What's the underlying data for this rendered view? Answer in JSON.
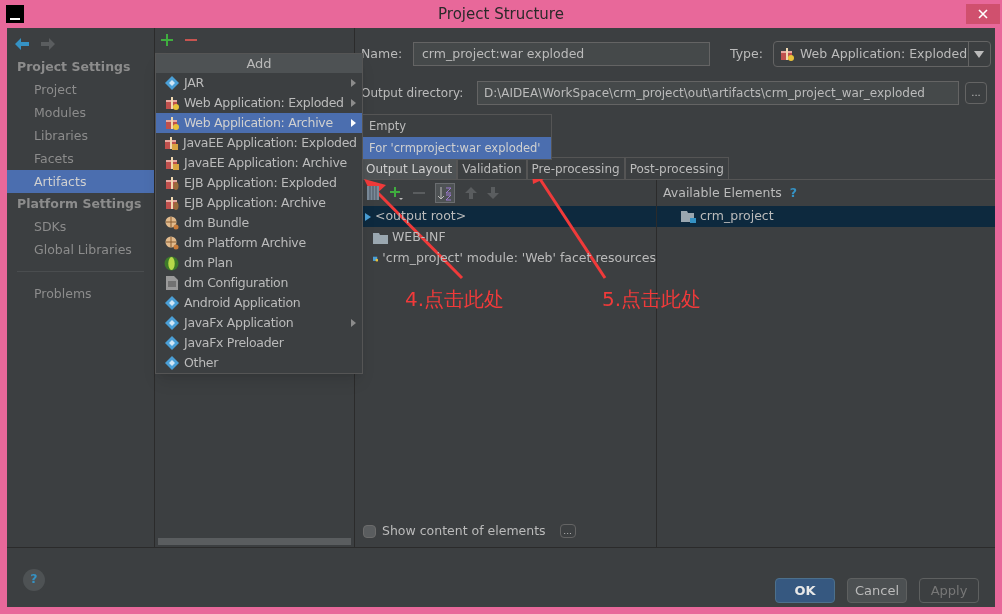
{
  "window": {
    "title": "Project Structure"
  },
  "sidebar": {
    "sections": [
      {
        "title": "Project Settings",
        "items": [
          {
            "label": "Project",
            "selected": false
          },
          {
            "label": "Modules",
            "selected": false
          },
          {
            "label": "Libraries",
            "selected": false
          },
          {
            "label": "Facets",
            "selected": false
          },
          {
            "label": "Artifacts",
            "selected": true
          }
        ]
      },
      {
        "title": "Platform Settings",
        "items": [
          {
            "label": "SDKs",
            "selected": false
          },
          {
            "label": "Global Libraries",
            "selected": false
          }
        ]
      }
    ],
    "bottom_items": [
      {
        "label": "Problems",
        "selected": false
      }
    ]
  },
  "add_menu": {
    "title": "Add",
    "items": [
      {
        "label": "JAR",
        "kind": "diamond",
        "submenu": true,
        "selected": false
      },
      {
        "label": "Web Application: Exploded",
        "kind": "web",
        "submenu": true,
        "selected": false
      },
      {
        "label": "Web Application: Archive",
        "kind": "web",
        "submenu": true,
        "selected": true
      },
      {
        "label": "JavaEE Application: Exploded",
        "kind": "ee",
        "submenu": false,
        "selected": false
      },
      {
        "label": "JavaEE Application: Archive",
        "kind": "ee",
        "submenu": false,
        "selected": false
      },
      {
        "label": "EJB Application: Exploded",
        "kind": "ejb",
        "submenu": false,
        "selected": false
      },
      {
        "label": "EJB Application: Archive",
        "kind": "ejb",
        "submenu": false,
        "selected": false
      },
      {
        "label": "dm Bundle",
        "kind": "bundle",
        "submenu": false,
        "selected": false
      },
      {
        "label": "dm Platform Archive",
        "kind": "bundle",
        "submenu": false,
        "selected": false
      },
      {
        "label": "dm Plan",
        "kind": "plan",
        "submenu": false,
        "selected": false
      },
      {
        "label": "dm Configuration",
        "kind": "doc",
        "submenu": false,
        "selected": false
      },
      {
        "label": "Android Application",
        "kind": "diamond",
        "submenu": false,
        "selected": false
      },
      {
        "label": "JavaFx Application",
        "kind": "diamond",
        "submenu": true,
        "selected": false
      },
      {
        "label": "JavaFx Preloader",
        "kind": "diamond",
        "submenu": false,
        "selected": false
      },
      {
        "label": "Other",
        "kind": "diamond",
        "submenu": false,
        "selected": false
      }
    ]
  },
  "submenu": {
    "items": [
      {
        "label": "Empty",
        "selected": false
      },
      {
        "label": "For 'crmproject:war exploded'",
        "selected": true
      }
    ]
  },
  "form": {
    "name_label": "Name:",
    "name_value": "crm_project:war exploded",
    "type_label": "Type:",
    "type_value": "Web Application: Exploded",
    "output_label": "Output directory:",
    "output_value": "D:\\AIDEA\\WorkSpace\\crm_project\\out\\artifacts\\crm_project_war_exploded",
    "browse": "..."
  },
  "tabs": [
    {
      "label": "Output Layout",
      "selected": true
    },
    {
      "label": "Validation",
      "selected": false
    },
    {
      "label": "Pre-processing",
      "selected": false
    },
    {
      "label": "Post-processing",
      "selected": false
    }
  ],
  "layout_tree": [
    {
      "label": "<output root>",
      "kind": "root",
      "selected": true
    },
    {
      "label": "WEB-INF",
      "kind": "folder",
      "selected": false
    },
    {
      "label": "'crm_project' module: 'Web' facet resources",
      "kind": "module",
      "selected": false
    }
  ],
  "available": {
    "title": "Available Elements",
    "help": "?",
    "items": [
      {
        "label": "crm_project",
        "selected": true
      }
    ]
  },
  "show_content": {
    "label": "Show content of elements",
    "checked": false,
    "more": "..."
  },
  "buttons": [
    {
      "label": "OK",
      "kind": "default"
    },
    {
      "label": "Cancel",
      "kind": "normal"
    },
    {
      "label": "Apply",
      "kind": "disabled"
    }
  ],
  "annotations": [
    {
      "label": "4.点击此处"
    },
    {
      "label": "5.点击此处"
    }
  ]
}
